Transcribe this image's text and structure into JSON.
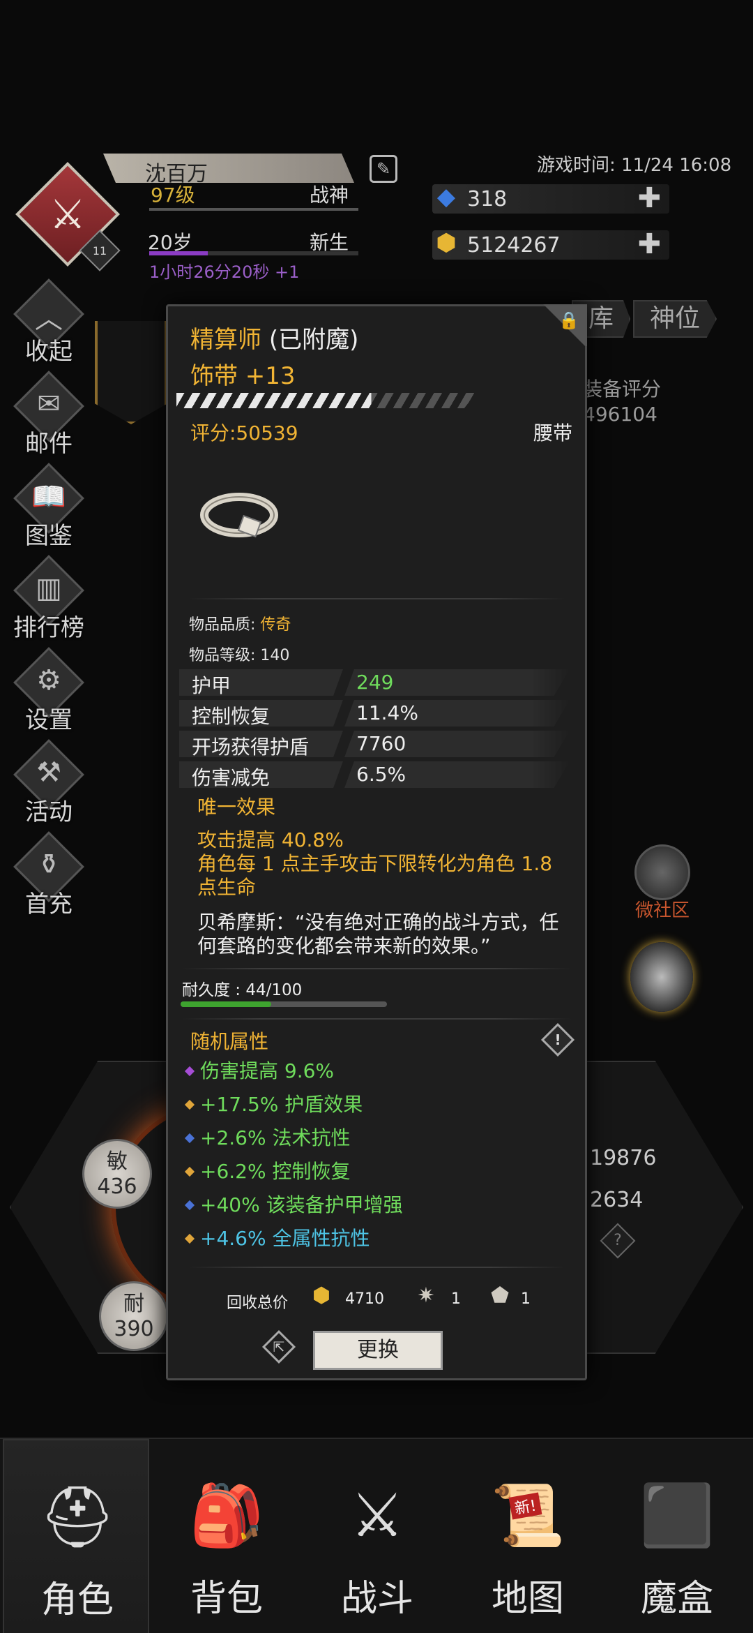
{
  "colors": {
    "gold": "#f1b434",
    "green": "#6fdc5c",
    "cyan": "#4ec5e6",
    "purple_gem": "#a64dd6",
    "gold_gem": "#e0a53a",
    "blue_gem": "#4a72d6"
  },
  "player": {
    "name": "沈百万",
    "level": "97级",
    "title": "战神",
    "age": "20岁",
    "status": "新生",
    "timer": "1小时26分20秒 +1",
    "badge_level": "11",
    "avatar_icon": "crossed-axes-icon"
  },
  "header": {
    "game_time": "游戏时间: 11/24 16:08",
    "currencies": [
      {
        "icon": "blue-crystal-icon",
        "value": "318"
      },
      {
        "icon": "gold-coin-icon",
        "value": "5124267"
      }
    ]
  },
  "side_menu": [
    {
      "label": "收起",
      "icon": "collapse-icon"
    },
    {
      "label": "邮件",
      "icon": "mail-icon"
    },
    {
      "label": "图鉴",
      "icon": "book-icon"
    },
    {
      "label": "排行榜",
      "icon": "leaderboard-icon"
    },
    {
      "label": "设置",
      "icon": "gear-icon"
    },
    {
      "label": "活动",
      "icon": "event-icon"
    },
    {
      "label": "首充",
      "icon": "first-charge-icon"
    }
  ],
  "background": {
    "tabs": [
      "库",
      "神位"
    ],
    "score_label": "装备评分",
    "score_value": "496104",
    "community": "微社区",
    "stats": {
      "agility_label": "敏",
      "agility": "436",
      "endurance_label": "耐",
      "endurance": "390",
      "right_num_1": "19876",
      "right_num_2": "2634"
    }
  },
  "item": {
    "name": "精算师",
    "enchant": "(已附魔)",
    "type": "饰带 +13",
    "enhance_progress": 0.65,
    "score": "评分:50539",
    "slot": "腰带",
    "icon": "belt-icon",
    "quality_label": "物品品质: ",
    "quality": "传奇",
    "item_level": "物品等级: 140",
    "stats": [
      {
        "name": "护甲",
        "value": "249",
        "highlight": true
      },
      {
        "name": "控制恢复",
        "value": "11.4%",
        "highlight": false
      },
      {
        "name": "开场获得护盾",
        "value": "7760",
        "highlight": false
      },
      {
        "name": "伤害减免",
        "value": "6.5%",
        "highlight": false
      }
    ],
    "unique_title": "唯一效果",
    "unique_effect": "攻击提高 40.8%\n角色每 1 点主手攻击下限转化为角色 1.8 点生命",
    "quote": "贝希摩斯：“没有绝对正确的战斗方式，任何套路的变化都会带来新的效果。”",
    "durability_label": "耐久度 : 44/100",
    "durability": 0.44,
    "random_title": "随机属性",
    "random_attrs": [
      {
        "text": "伤害提高 9.6%",
        "gem": "purple",
        "color": "#6fdc5c"
      },
      {
        "text": "+17.5% 护盾效果",
        "gem": "gold",
        "color": "#6fdc5c"
      },
      {
        "text": "+2.6% 法术抗性",
        "gem": "blue",
        "color": "#6fdc5c"
      },
      {
        "text": "+6.2% 控制恢复",
        "gem": "gold",
        "color": "#6fdc5c"
      },
      {
        "text": "+40% 该装备护甲增强",
        "gem": "blue",
        "color": "#6fdc5c"
      },
      {
        "text": "+4.6% 全属性抗性",
        "gem": "gold",
        "color": "#4ec5e6"
      }
    ],
    "recycle_label": "回收总价",
    "recycle": [
      {
        "icon": "gold-coin-icon",
        "value": "4710"
      },
      {
        "icon": "gear-stone-icon",
        "value": "1"
      },
      {
        "icon": "scroll-stone-icon",
        "value": "1"
      }
    ],
    "replace_label": "更换"
  },
  "bottom_nav": [
    {
      "label": "角色",
      "icon": "helmet-icon",
      "active": true
    },
    {
      "label": "背包",
      "icon": "backpack-icon",
      "active": false
    },
    {
      "label": "战斗",
      "icon": "sword-shield-icon",
      "active": false
    },
    {
      "label": "地图",
      "icon": "scroll-map-icon",
      "active": false,
      "badge": "新!"
    },
    {
      "label": "魔盒",
      "icon": "magic-box-icon",
      "active": false
    }
  ]
}
